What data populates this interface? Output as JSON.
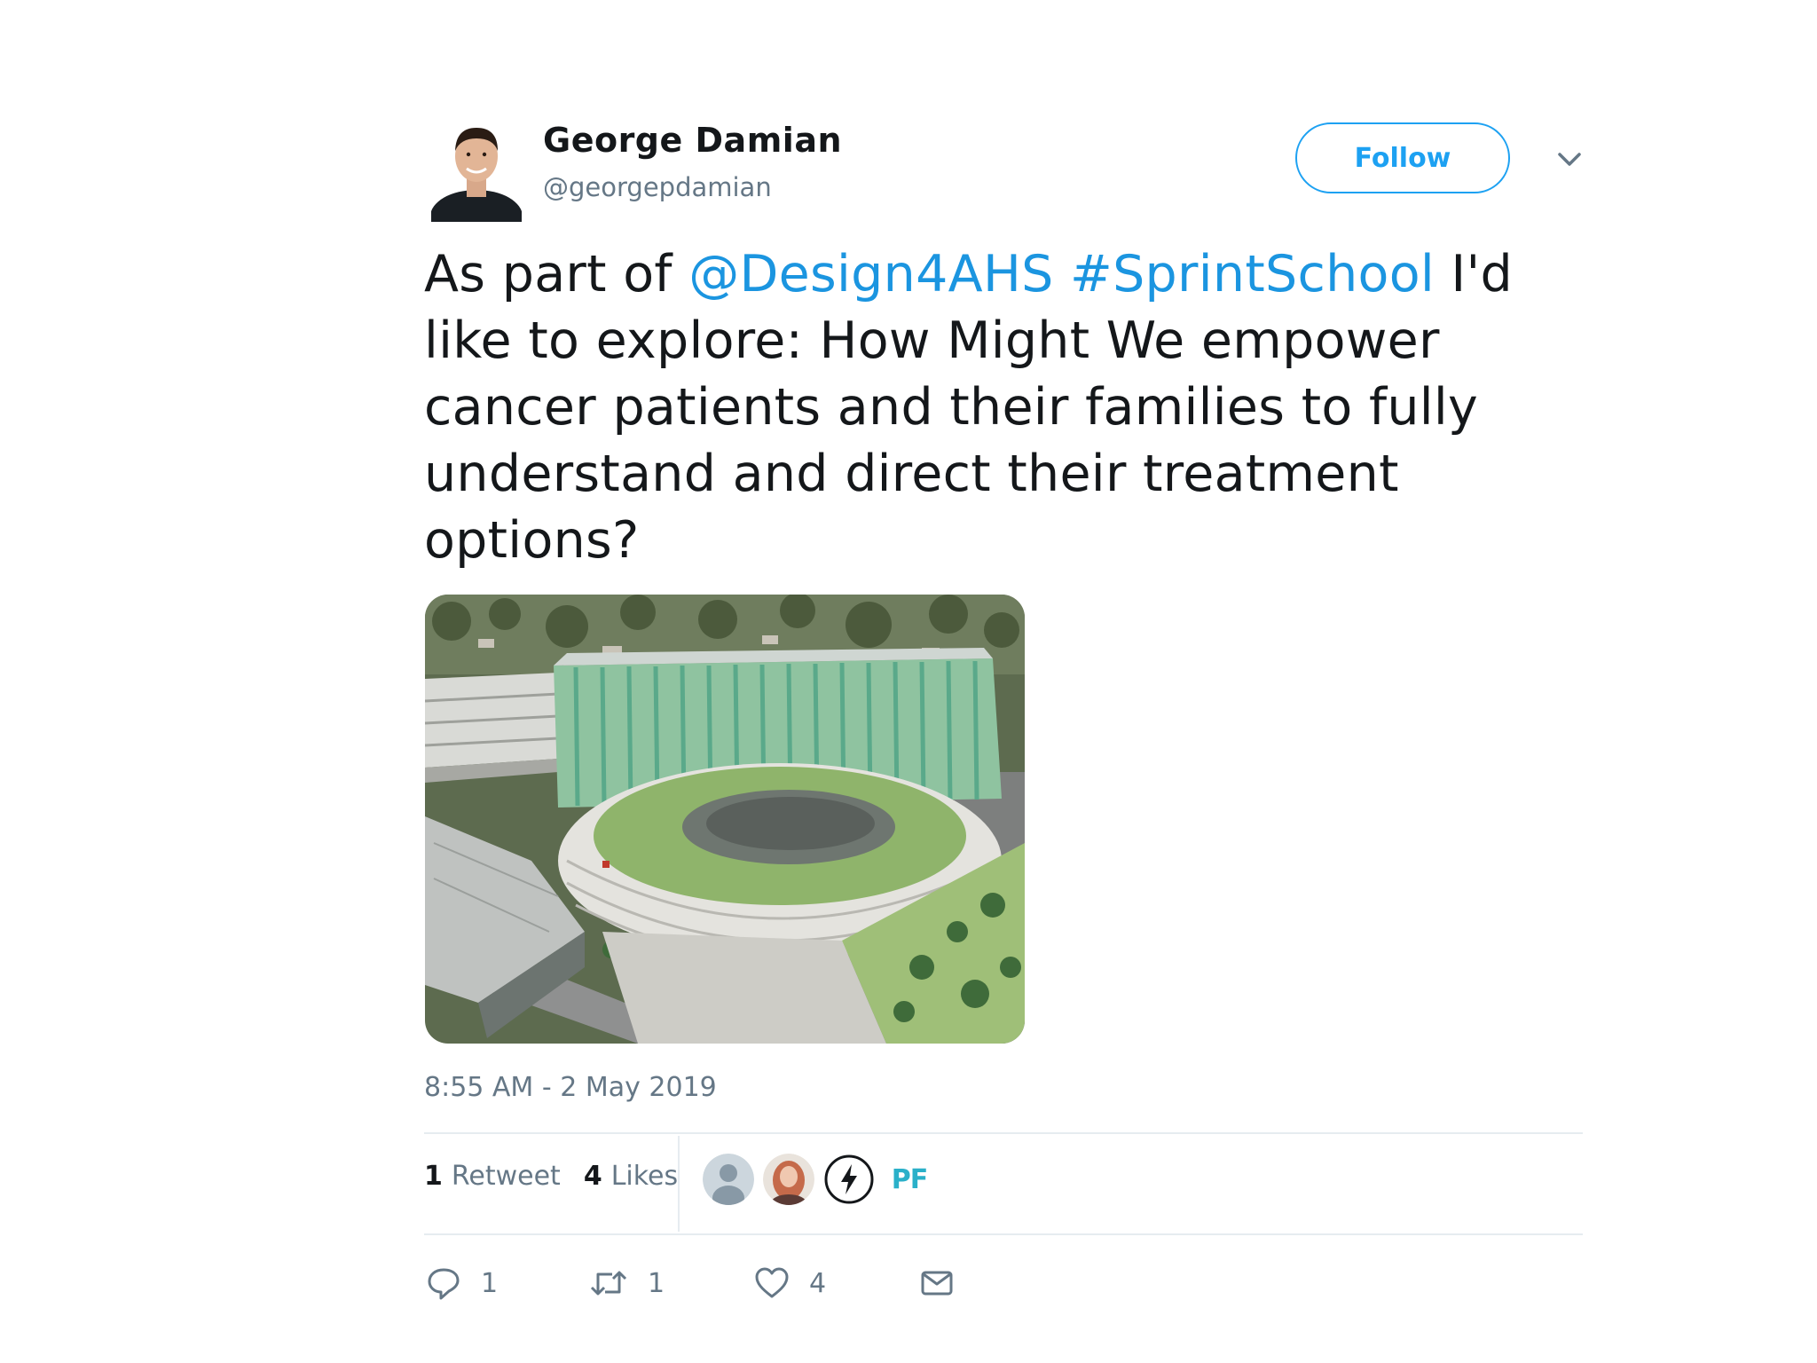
{
  "user": {
    "name": "George Damian",
    "handle": "@georgepdamian",
    "follow_label": "Follow"
  },
  "tweet": {
    "text_before": "As part of ",
    "mention": "@Design4AHS",
    "space": " ",
    "hashtag": "#SprintSchool",
    "text_after": " I'd like to explore: How Might We empower cancer patients and their families to fully understand and direct their treatment options?",
    "timestamp": "8:55 AM - 2 May 2019"
  },
  "stats": {
    "retweets_count": "1",
    "retweets_label": "Retweet",
    "likes_count": "4",
    "likes_label": "Likes",
    "liker_badge": "PF"
  },
  "actions": {
    "reply_count": "1",
    "retweet_count": "1",
    "like_count": "4"
  },
  "colors": {
    "accent": "#1da1f2",
    "link": "#1b95e0",
    "secondary_text": "#657786",
    "divider": "#e6ecf0"
  },
  "icons": [
    "chevron-down-icon",
    "reply-icon",
    "retweet-icon",
    "heart-icon",
    "direct-message-icon"
  ]
}
